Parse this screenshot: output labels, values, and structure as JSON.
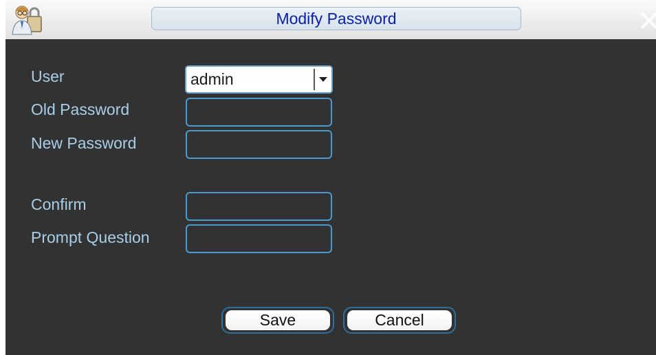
{
  "window": {
    "title": "Modify Password",
    "close_glyph": "✕"
  },
  "form": {
    "user_label": "User",
    "user_value": "admin",
    "old_password_label": "Old Password",
    "old_password_value": "",
    "new_password_label": "New Password",
    "new_password_value": "",
    "confirm_label": "Confirm",
    "confirm_value": "",
    "prompt_question_label": "Prompt Question",
    "prompt_question_value": ""
  },
  "buttons": {
    "save_label": "Save",
    "cancel_label": "Cancel"
  },
  "colors": {
    "panel_bg": "#323232",
    "label_text": "#a9cfe8",
    "field_border": "#4c9bd0",
    "title_text": "#0a1ea8"
  },
  "icons": {
    "app": "user-lock-icon",
    "close": "close-icon",
    "dropdown": "chevron-down-icon"
  }
}
